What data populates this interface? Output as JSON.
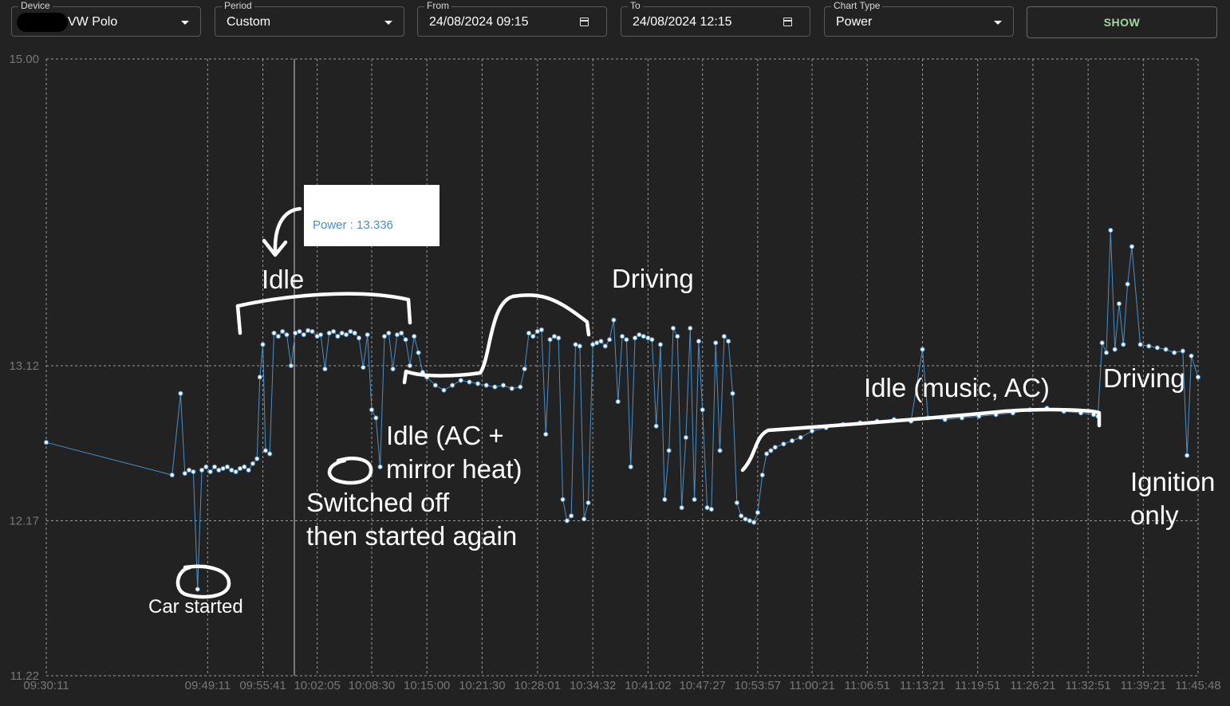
{
  "controls": {
    "device": {
      "label": "Device",
      "value": "VW Polo"
    },
    "period": {
      "label": "Period",
      "value": "Custom"
    },
    "from": {
      "label": "From",
      "value": "24/08/2024 09:15"
    },
    "to": {
      "label": "To",
      "value": "24/08/2024 12:15"
    },
    "chart_type": {
      "label": "Chart Type",
      "value": "Power"
    },
    "show_label": "SHOW"
  },
  "tooltip": {
    "text": "Power : 13.336"
  },
  "annotations": {
    "car_started": "Car started",
    "idle_1": "Idle",
    "switched_line1": "Switched off",
    "switched_line2": "then started again",
    "idle_ac_line1": "Idle (AC +",
    "idle_ac_line2": "mirror heat)",
    "driving_1": "Driving",
    "idle_music": "Idle (music, AC)",
    "driving_2": "Driving",
    "ignition_line1": "Ignition",
    "ignition_line2": "only"
  },
  "colors": {
    "line": "#4a90c8",
    "point_fill": "#ffffff",
    "grid": "#9a9a9a",
    "background": "#222222"
  },
  "chart_data": {
    "type": "line",
    "title": "",
    "xlabel": "",
    "ylabel": "",
    "ylim": [
      11.22,
      15.0
    ],
    "yticks": [
      "15.00",
      "13.12",
      "12.17",
      "11.22"
    ],
    "xticks": [
      "09:30:11",
      "09:49:11",
      "09:55:41",
      "10:02:05",
      "10:08:30",
      "10:15:00",
      "10:21:30",
      "10:28:01",
      "10:34:32",
      "10:41:02",
      "10:47:27",
      "10:53:57",
      "11:00:21",
      "11:06:51",
      "11:13:21",
      "11:19:51",
      "11:26:21",
      "11:32:51",
      "11:39:21",
      "11:45:48"
    ],
    "grid": true,
    "series": [
      {
        "x": [
          "09:30:11",
          "09:45:00",
          "09:46:00",
          "09:46:30",
          "09:47:00",
          "09:47:30",
          "09:48:00",
          "09:48:30",
          "09:49:00",
          "09:49:30",
          "09:50:00",
          "09:50:30",
          "09:51:00",
          "09:51:30",
          "09:52:00",
          "09:52:30",
          "09:53:00",
          "09:53:30",
          "09:54:00",
          "09:54:30",
          "09:55:00",
          "09:55:20",
          "09:55:41",
          "09:56:00",
          "09:56:30",
          "09:57:00",
          "09:57:30",
          "09:58:00",
          "09:58:30",
          "09:59:00",
          "09:59:30",
          "10:00:00",
          "10:00:30",
          "10:01:00",
          "10:01:30",
          "10:02:05",
          "10:02:30",
          "10:03:00",
          "10:03:30",
          "10:04:00",
          "10:04:30",
          "10:05:00",
          "10:05:30",
          "10:06:00",
          "10:06:30",
          "10:07:00",
          "10:07:30",
          "10:08:00",
          "10:08:30",
          "10:09:00",
          "10:09:30",
          "10:10:00",
          "10:10:30",
          "10:11:00",
          "10:11:30",
          "10:12:00",
          "10:12:30",
          "10:13:00",
          "10:13:30",
          "10:14:00",
          "10:14:30",
          "10:15:00",
          "10:16:00",
          "10:17:00",
          "10:18:00",
          "10:19:00",
          "10:20:00",
          "10:21:00",
          "10:22:00",
          "10:23:00",
          "10:24:00",
          "10:25:00",
          "10:26:00",
          "10:26:30",
          "10:27:00",
          "10:27:30",
          "10:28:01",
          "10:28:30",
          "10:29:00",
          "10:29:30",
          "10:30:00",
          "10:30:30",
          "10:31:00",
          "10:31:30",
          "10:32:00",
          "10:32:30",
          "10:33:00",
          "10:33:30",
          "10:34:00",
          "10:34:32",
          "10:35:00",
          "10:35:30",
          "10:36:00",
          "10:36:30",
          "10:37:00",
          "10:37:30",
          "10:38:00",
          "10:38:30",
          "10:39:00",
          "10:39:30",
          "10:40:00",
          "10:40:30",
          "10:41:02",
          "10:41:30",
          "10:42:00",
          "10:42:30",
          "10:43:00",
          "10:43:30",
          "10:44:00",
          "10:44:30",
          "10:45:00",
          "10:45:30",
          "10:46:00",
          "10:46:30",
          "10:47:00",
          "10:47:27",
          "10:48:00",
          "10:48:30",
          "10:49:00",
          "10:49:30",
          "10:50:00",
          "10:50:30",
          "10:51:00",
          "10:51:30",
          "10:52:00",
          "10:52:30",
          "10:53:00",
          "10:53:30",
          "10:53:57",
          "10:54:30",
          "10:55:00",
          "10:55:30",
          "10:56:00",
          "10:57:00",
          "10:58:00",
          "10:59:00",
          "11:00:21",
          "11:02:00",
          "11:04:00",
          "11:06:00",
          "11:08:00",
          "11:10:00",
          "11:12:00",
          "11:13:21",
          "11:14:00",
          "11:16:00",
          "11:18:00",
          "11:20:00",
          "11:22:00",
          "11:24:00",
          "11:26:00",
          "11:28:00",
          "11:30:00",
          "11:32:00",
          "11:33:30",
          "11:34:00",
          "11:34:30",
          "11:35:00",
          "11:35:30",
          "11:36:00",
          "11:36:30",
          "11:37:00",
          "11:37:30",
          "11:38:00",
          "11:39:00",
          "11:40:00",
          "11:41:00",
          "11:42:00",
          "11:43:00",
          "11:44:00",
          "11:44:30",
          "11:45:00",
          "11:45:48"
        ],
        "values": [
          12.65,
          12.45,
          12.95,
          12.46,
          12.48,
          12.47,
          11.75,
          12.48,
          12.5,
          12.47,
          12.5,
          12.48,
          12.49,
          12.5,
          12.48,
          12.47,
          12.49,
          12.5,
          12.48,
          12.52,
          12.55,
          13.05,
          13.25,
          12.6,
          12.58,
          13.32,
          13.3,
          13.33,
          13.31,
          13.12,
          13.32,
          13.33,
          13.31,
          13.336,
          13.33,
          13.3,
          13.31,
          13.1,
          13.32,
          13.33,
          13.3,
          13.32,
          13.31,
          13.33,
          13.32,
          13.29,
          13.11,
          13.31,
          12.85,
          12.8,
          12.5,
          13.3,
          13.32,
          13.1,
          13.31,
          13.32,
          13.28,
          13.12,
          13.3,
          13.2,
          13.08,
          13.05,
          13.0,
          12.97,
          13.0,
          13.03,
          13.02,
          13.01,
          13.0,
          12.99,
          13.0,
          12.98,
          12.99,
          13.1,
          13.32,
          13.3,
          13.33,
          13.34,
          12.7,
          13.28,
          13.3,
          13.29,
          12.3,
          12.17,
          12.2,
          13.25,
          13.24,
          12.18,
          12.28,
          13.25,
          13.26,
          13.27,
          13.24,
          13.28,
          13.4,
          12.9,
          13.3,
          13.28,
          12.5,
          13.29,
          13.31,
          13.3,
          13.29,
          13.28,
          12.75,
          13.25,
          12.3,
          12.6,
          13.35,
          13.3,
          12.25,
          12.68,
          13.35,
          12.3,
          13.27,
          12.85,
          12.25,
          12.24,
          13.26,
          12.6,
          13.3,
          13.27,
          12.95,
          12.28,
          12.2,
          12.18,
          12.17,
          12.16,
          12.22,
          12.45,
          12.58,
          12.6,
          12.62,
          12.64,
          12.66,
          12.68,
          12.72,
          12.74,
          12.76,
          12.77,
          12.78,
          12.79,
          12.78,
          13.22,
          12.8,
          12.79,
          12.8,
          12.81,
          12.82,
          12.83,
          12.85,
          12.86,
          12.84,
          12.83,
          12.82,
          12.81,
          13.26,
          13.2,
          13.95,
          13.22,
          13.5,
          13.25,
          13.62,
          13.85,
          13.25,
          13.24,
          13.23,
          13.22,
          13.2,
          13.21,
          12.57,
          13.18,
          13.05
        ]
      }
    ]
  }
}
